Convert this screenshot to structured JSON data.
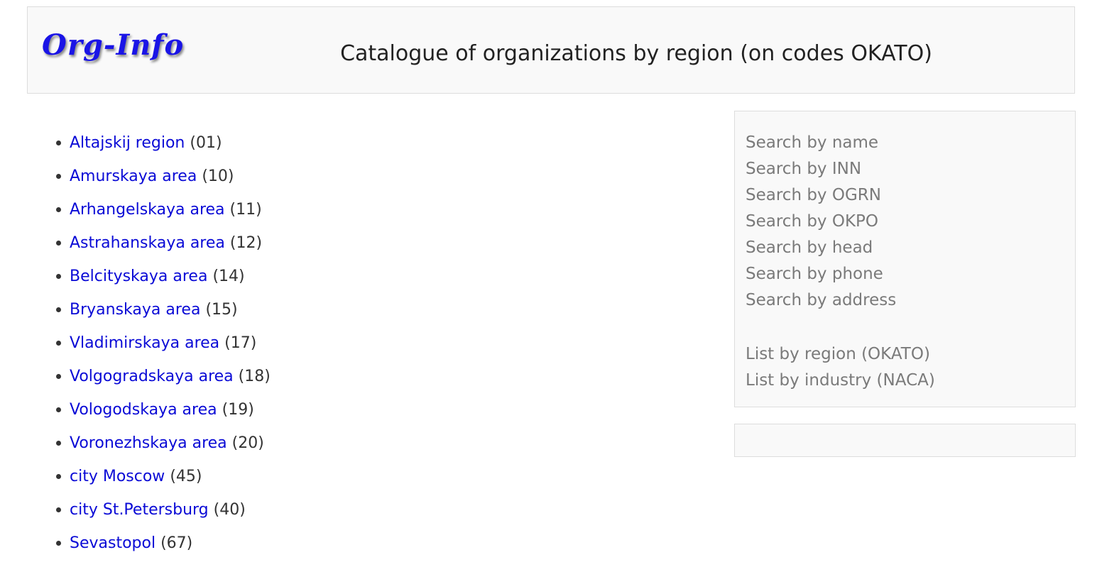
{
  "header": {
    "logo_text": "Org-Info",
    "title": "Catalogue of organizations by region (on codes OKATO)"
  },
  "regions": [
    {
      "name": "Altajskij region",
      "code": "(01)"
    },
    {
      "name": "Amurskaya area",
      "code": "(10)"
    },
    {
      "name": "Arhangelskaya area",
      "code": "(11)"
    },
    {
      "name": "Astrahanskaya area",
      "code": "(12)"
    },
    {
      "name": "Belcityskaya area",
      "code": "(14)"
    },
    {
      "name": "Bryanskaya area",
      "code": "(15)"
    },
    {
      "name": "Vladimirskaya area",
      "code": "(17)"
    },
    {
      "name": "Volgogradskaya area",
      "code": "(18)"
    },
    {
      "name": "Vologodskaya area",
      "code": "(19)"
    },
    {
      "name": "Voronezhskaya area",
      "code": "(20)"
    },
    {
      "name": "city Moscow",
      "code": "(45)"
    },
    {
      "name": "city St.Petersburg",
      "code": "(40)"
    },
    {
      "name": "Sevastopol",
      "code": "(67)"
    }
  ],
  "sidebar": {
    "search_links": [
      "Search by name",
      "Search by INN",
      "Search by OGRN",
      "Search by OKPO",
      "Search by head",
      "Search by phone",
      "Search by address"
    ],
    "list_links": [
      "List by region (OKATO)",
      "List by industry (NACA)"
    ]
  },
  "colors": {
    "link": "#0a0ad6",
    "logo": "#1a14e6",
    "panel_bg": "#f9f9f9",
    "sidebar_text": "#7a7a7a"
  }
}
